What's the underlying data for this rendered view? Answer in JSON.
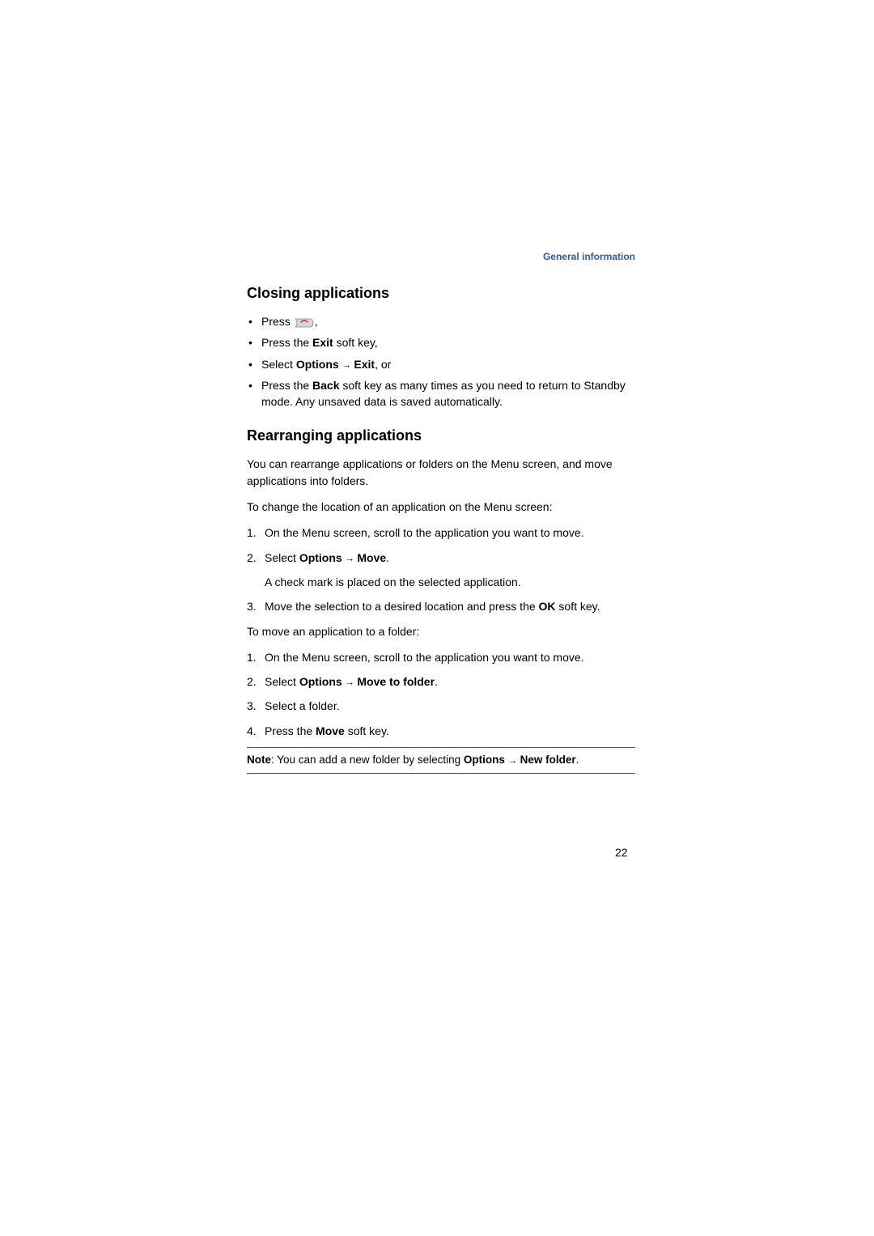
{
  "header": {
    "section_link": "General information"
  },
  "closing": {
    "heading": "Closing applications",
    "items": {
      "press_end": {
        "pre": "Press ",
        "post": ","
      },
      "press_exit": {
        "pre": "Press the ",
        "b1": "Exit",
        "post": " soft key,"
      },
      "select_exit": {
        "pre": "Select ",
        "b1": "Options",
        "arrow": " → ",
        "b2": "Exit",
        "post": ", or"
      },
      "press_back": {
        "pre": "Press the ",
        "b1": "Back",
        "post": " soft key as many times as you need to return to Standby mode. Any unsaved data is saved automatically."
      }
    }
  },
  "rearranging": {
    "heading": "Rearranging applications",
    "intro": "You can rearrange applications or folders on the Menu screen, and move applications into folders.",
    "lead1": "To change the location of an application on the Menu screen:",
    "step1_1": "On the Menu screen, scroll to the application you want to move.",
    "step1_2": {
      "pre": "Select ",
      "b1": "Options",
      "arrow": " → ",
      "b2": "Move",
      "post": "."
    },
    "step1_2_sub": "A check mark is placed on the selected application.",
    "step1_3": {
      "pre": "Move the selection to a desired location and press the ",
      "b1": "OK",
      "post": " soft key."
    },
    "lead2": "To move an application to a folder:",
    "step2_1": "On the Menu screen, scroll to the application you want to move.",
    "step2_2": {
      "pre": "Select ",
      "b1": "Options",
      "arrow": " → ",
      "b2": "Move to folder",
      "post": "."
    },
    "step2_3": "Select a folder.",
    "step2_4": {
      "pre": "Press the ",
      "b1": "Move",
      "post": " soft key."
    },
    "note": {
      "b0": "Note",
      "pre": ": You can add a new folder by selecting ",
      "b1": "Options",
      "arrow": " → ",
      "b2": "New folder",
      "post": "."
    }
  },
  "page_number": "22",
  "numbers": {
    "n1": "1.",
    "n2": "2.",
    "n3": "3.",
    "n4": "4."
  }
}
